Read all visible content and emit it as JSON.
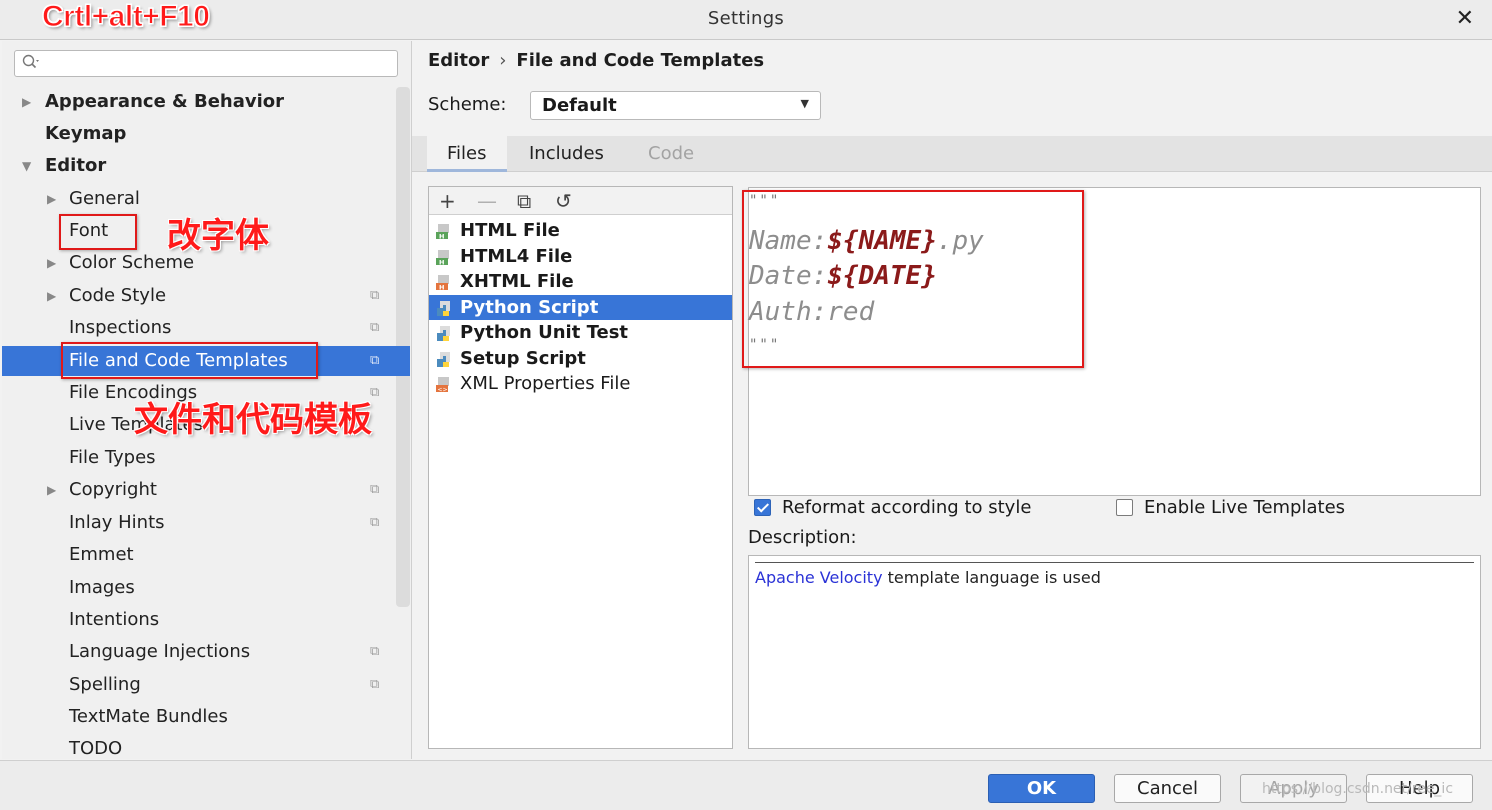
{
  "window": {
    "title": "Settings",
    "close_glyph": "✕"
  },
  "annotations": {
    "shortcut": "Crtl+alt+F10",
    "font_note": "改字体",
    "templates_note": "文件和代码模板"
  },
  "sidebar": {
    "search_placeholder": "",
    "search_icon": "search-icon",
    "items": [
      {
        "label": "Appearance & Behavior",
        "bold": true,
        "arrow": "▶"
      },
      {
        "label": "Keymap",
        "bold": true,
        "arrow": ""
      },
      {
        "label": "Editor",
        "bold": true,
        "arrow": "▼"
      },
      {
        "label": "General",
        "arrow": "▶"
      },
      {
        "label": "Font",
        "arrow": ""
      },
      {
        "label": "Color Scheme",
        "arrow": "▶"
      },
      {
        "label": "Code Style",
        "arrow": "▶"
      },
      {
        "label": "Inspections",
        "arrow": ""
      },
      {
        "label": "File and Code Templates",
        "arrow": "",
        "selected": true
      },
      {
        "label": "File Encodings",
        "arrow": ""
      },
      {
        "label": "Live Templates",
        "arrow": ""
      },
      {
        "label": "File Types",
        "arrow": ""
      },
      {
        "label": "Copyright",
        "arrow": "▶"
      },
      {
        "label": "Inlay Hints",
        "arrow": ""
      },
      {
        "label": "Emmet",
        "arrow": ""
      },
      {
        "label": "Images",
        "arrow": ""
      },
      {
        "label": "Intentions",
        "arrow": ""
      },
      {
        "label": "Language Injections",
        "arrow": ""
      },
      {
        "label": "Spelling",
        "arrow": ""
      },
      {
        "label": "TextMate Bundles",
        "arrow": ""
      },
      {
        "label": "TODO",
        "arrow": ""
      }
    ]
  },
  "breadcrumb": {
    "parent": "Editor",
    "separator": "›",
    "current": "File and Code Templates"
  },
  "scheme": {
    "label": "Scheme:",
    "value": "Default",
    "caret": "▼"
  },
  "tabs": [
    {
      "label": "Files",
      "active": true
    },
    {
      "label": "Includes"
    },
    {
      "label": "Code",
      "disabled": true
    }
  ],
  "toolbar": {
    "add": "+",
    "remove": "—",
    "copy": "⧉",
    "reset": "↺"
  },
  "files": [
    {
      "label": "HTML File",
      "bold": true,
      "icon": "html-file-icon",
      "color": "#5aa35a"
    },
    {
      "label": "HTML4 File",
      "bold": true,
      "icon": "html-file-icon",
      "color": "#5aa35a"
    },
    {
      "label": "XHTML File",
      "bold": true,
      "icon": "xhtml-file-icon",
      "color": "#e4743e"
    },
    {
      "label": "Python Script",
      "bold": true,
      "icon": "python-file-icon",
      "color": "#4b8bbe",
      "selected": true
    },
    {
      "label": "Python Unit Test",
      "bold": true,
      "icon": "python-file-icon",
      "color": "#4b8bbe"
    },
    {
      "label": "Setup Script",
      "bold": true,
      "icon": "python-file-icon",
      "color": "#4b8bbe"
    },
    {
      "label": "XML Properties File",
      "bold": false,
      "icon": "xml-file-icon",
      "color": "#e4743e"
    }
  ],
  "editor": {
    "open_quotes": "\"\"\"",
    "name_label": "Name:",
    "name_var": "${NAME}",
    "name_suffix": ".py",
    "date_label": "Date:",
    "date_var": "${DATE}",
    "auth_line": "Auth:red",
    "close_quotes": "\"\"\""
  },
  "options": {
    "reformat": {
      "label": "Reformat according to style",
      "checked": true
    },
    "live_templates": {
      "label": "Enable Live Templates",
      "checked": false
    }
  },
  "description": {
    "label": "Description:",
    "link": "Apache Velocity",
    "text": " template language is used"
  },
  "buttons": {
    "ok": "OK",
    "cancel": "Cancel",
    "apply": "Apply",
    "help": "Help"
  },
  "watermark": "https://blog.csdn.net/ree_ic",
  "colors": {
    "accent": "#3875d7",
    "annotation": "#e01919",
    "template_var": "#8b1a1a",
    "link": "#2a32d6"
  }
}
